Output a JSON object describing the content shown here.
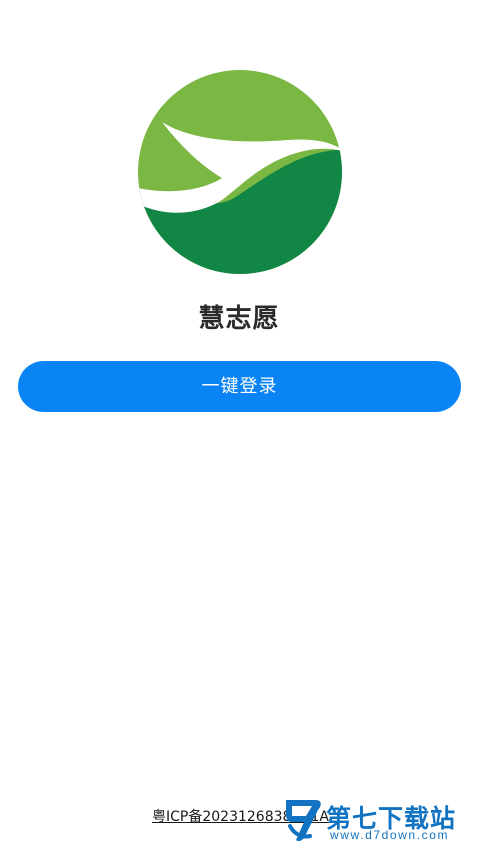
{
  "app": {
    "name": "慧志愿"
  },
  "login": {
    "button_label": "一键登录"
  },
  "footer": {
    "icp_text": "粤ICP备2023126838号-1A"
  },
  "watermark": {
    "title": "第七下载站",
    "url": "www.d7down.com"
  },
  "colors": {
    "primary_button": "#0a84f5",
    "logo_light_green": "#7bb843",
    "logo_dark_green": "#128645",
    "watermark_blue": "#1173c2"
  }
}
